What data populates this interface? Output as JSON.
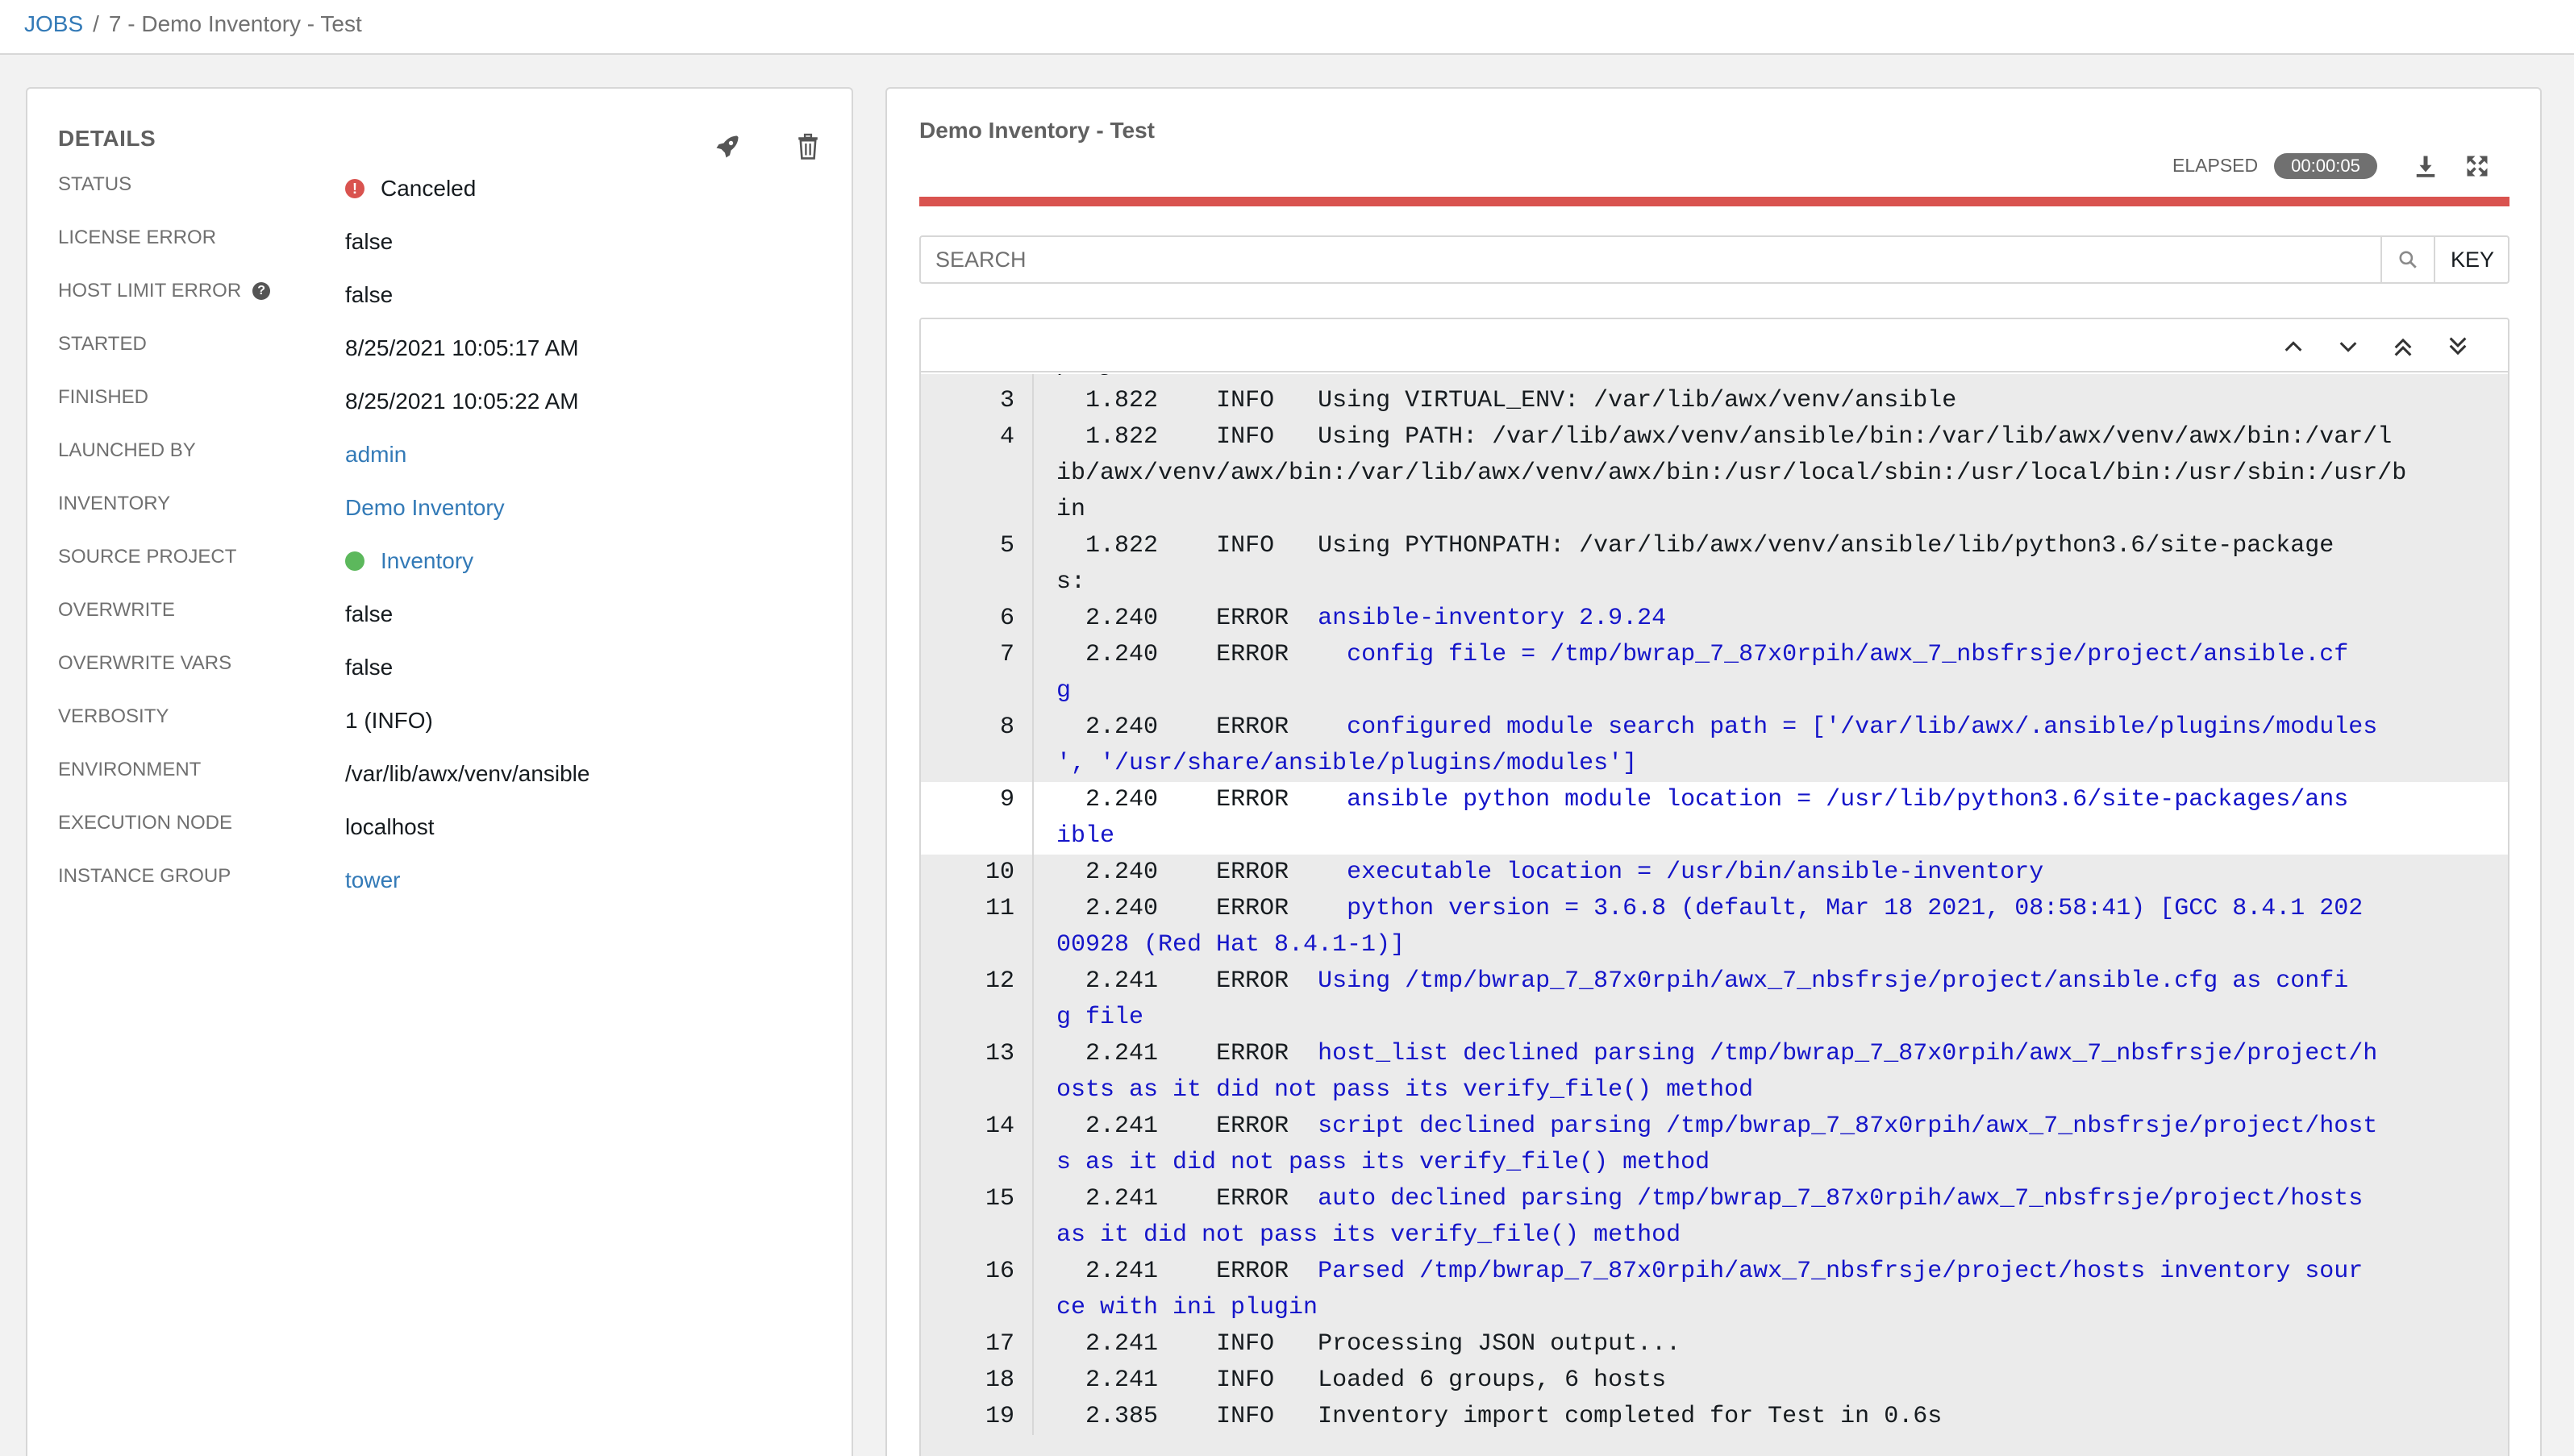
{
  "breadcrumb": {
    "root": "JOBS",
    "separator": "/",
    "current": "7 - Demo Inventory - Test"
  },
  "details": {
    "title": "DETAILS",
    "rows": [
      {
        "label": "STATUS",
        "value": "Canceled"
      },
      {
        "label": "LICENSE ERROR",
        "value": "false"
      },
      {
        "label": "HOST LIMIT ERROR",
        "value": "false"
      },
      {
        "label": "STARTED",
        "value": "8/25/2021 10:05:17 AM"
      },
      {
        "label": "FINISHED",
        "value": "8/25/2021 10:05:22 AM"
      },
      {
        "label": "LAUNCHED BY",
        "value": "admin"
      },
      {
        "label": "INVENTORY",
        "value": "Demo Inventory"
      },
      {
        "label": "SOURCE PROJECT",
        "value": "Inventory"
      },
      {
        "label": "OVERWRITE",
        "value": "false"
      },
      {
        "label": "OVERWRITE VARS",
        "value": "false"
      },
      {
        "label": "VERBOSITY",
        "value": "1 (INFO)"
      },
      {
        "label": "ENVIRONMENT",
        "value": "/var/lib/awx/venv/ansible"
      },
      {
        "label": "EXECUTION NODE",
        "value": "localhost"
      },
      {
        "label": "INSTANCE GROUP",
        "value": "tower"
      }
    ]
  },
  "output": {
    "title": "Demo Inventory - Test",
    "elapsed_label": "ELAPSED",
    "elapsed_value": "00:00:05",
    "progress_color": "#d9534f",
    "search_placeholder": "SEARCH",
    "key_label": "KEY",
    "log": [
      {
        "num": "",
        "time": "",
        "level": "",
        "msg": "project/hosts",
        "kind": "info"
      },
      {
        "num": "3",
        "time": "1.822",
        "level": "INFO",
        "msg": "Using VIRTUAL_ENV: /var/lib/awx/venv/ansible",
        "kind": "info"
      },
      {
        "num": "4",
        "time": "1.822",
        "level": "INFO",
        "msg": "Using PATH: /var/lib/awx/venv/ansible/bin:/var/lib/awx/venv/awx/bin:/var/l",
        "kind": "info"
      },
      {
        "num": "",
        "time": "",
        "level": "",
        "msg": "ib/awx/venv/awx/bin:/var/lib/awx/venv/awx/bin:/usr/local/sbin:/usr/local/bin:/usr/sbin:/usr/b",
        "kind": "info"
      },
      {
        "num": "",
        "time": "",
        "level": "",
        "msg": "in",
        "kind": "info"
      },
      {
        "num": "5",
        "time": "1.822",
        "level": "INFO",
        "msg": "Using PYTHONPATH: /var/lib/awx/venv/ansible/lib/python3.6/site-package",
        "kind": "info"
      },
      {
        "num": "",
        "time": "",
        "level": "",
        "msg": "s:",
        "kind": "info"
      },
      {
        "num": "6",
        "time": "2.240",
        "level": "ERROR",
        "msg": "ansible-inventory 2.9.24",
        "kind": "err"
      },
      {
        "num": "7",
        "time": "2.240",
        "level": "ERROR",
        "msg": "  config file = /tmp/bwrap_7_87x0rpih/awx_7_nbsfrsje/project/ansible.cf",
        "kind": "err"
      },
      {
        "num": "",
        "time": "",
        "level": "",
        "msg": "g",
        "kind": "err"
      },
      {
        "num": "8",
        "time": "2.240",
        "level": "ERROR",
        "msg": "  configured module search path = ['/var/lib/awx/.ansible/plugins/modules",
        "kind": "err"
      },
      {
        "num": "",
        "time": "",
        "level": "",
        "msg": "', '/usr/share/ansible/plugins/modules']",
        "kind": "err"
      },
      {
        "num": "9",
        "time": "2.240",
        "level": "ERROR",
        "msg": "  ansible python module location = /usr/lib/python3.6/site-packages/ans",
        "kind": "err",
        "hl": true
      },
      {
        "num": "",
        "time": "",
        "level": "",
        "msg": "ible",
        "kind": "err",
        "hl": true
      },
      {
        "num": "10",
        "time": "2.240",
        "level": "ERROR",
        "msg": "  executable location = /usr/bin/ansible-inventory",
        "kind": "err"
      },
      {
        "num": "11",
        "time": "2.240",
        "level": "ERROR",
        "msg": "  python version = 3.6.8 (default, Mar 18 2021, 08:58:41) [GCC 8.4.1 202",
        "kind": "err"
      },
      {
        "num": "",
        "time": "",
        "level": "",
        "msg": "00928 (Red Hat 8.4.1-1)]",
        "kind": "err"
      },
      {
        "num": "12",
        "time": "2.241",
        "level": "ERROR",
        "msg": "Using /tmp/bwrap_7_87x0rpih/awx_7_nbsfrsje/project/ansible.cfg as confi",
        "kind": "err"
      },
      {
        "num": "",
        "time": "",
        "level": "",
        "msg": "g file",
        "kind": "err"
      },
      {
        "num": "13",
        "time": "2.241",
        "level": "ERROR",
        "msg": "host_list declined parsing /tmp/bwrap_7_87x0rpih/awx_7_nbsfrsje/project/h",
        "kind": "err"
      },
      {
        "num": "",
        "time": "",
        "level": "",
        "msg": "osts as it did not pass its verify_file() method",
        "kind": "err"
      },
      {
        "num": "14",
        "time": "2.241",
        "level": "ERROR",
        "msg": "script declined parsing /tmp/bwrap_7_87x0rpih/awx_7_nbsfrsje/project/host",
        "kind": "err"
      },
      {
        "num": "",
        "time": "",
        "level": "",
        "msg": "s as it did not pass its verify_file() method",
        "kind": "err"
      },
      {
        "num": "15",
        "time": "2.241",
        "level": "ERROR",
        "msg": "auto declined parsing /tmp/bwrap_7_87x0rpih/awx_7_nbsfrsje/project/hosts",
        "kind": "err"
      },
      {
        "num": "",
        "time": "",
        "level": "",
        "msg": "as it did not pass its verify_file() method",
        "kind": "err"
      },
      {
        "num": "16",
        "time": "2.241",
        "level": "ERROR",
        "msg": "Parsed /tmp/bwrap_7_87x0rpih/awx_7_nbsfrsje/project/hosts inventory sour",
        "kind": "err"
      },
      {
        "num": "",
        "time": "",
        "level": "",
        "msg": "ce with ini plugin",
        "kind": "err"
      },
      {
        "num": "17",
        "time": "2.241",
        "level": "INFO",
        "msg": "Processing JSON output...",
        "kind": "info"
      },
      {
        "num": "18",
        "time": "2.241",
        "level": "INFO",
        "msg": "Loaded 6 groups, 6 hosts",
        "kind": "info"
      },
      {
        "num": "19",
        "time": "2.385",
        "level": "INFO",
        "msg": "Inventory import completed for Test in 0.6s",
        "kind": "info"
      }
    ]
  }
}
